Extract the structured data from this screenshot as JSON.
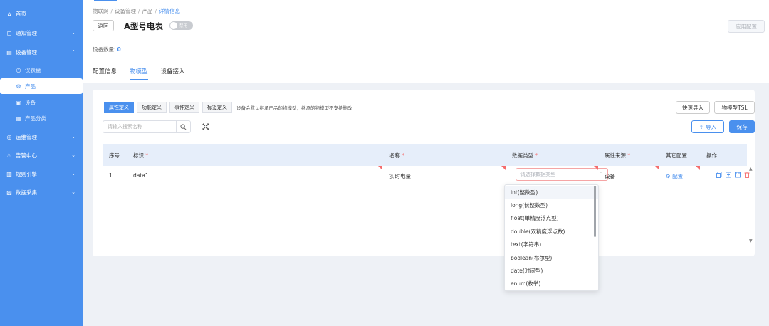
{
  "sidebar": {
    "items": [
      {
        "label": "首页",
        "icon": "home-icon"
      },
      {
        "label": "通知管理",
        "icon": "bell-icon"
      },
      {
        "label": "设备管理",
        "icon": "device-icon"
      },
      {
        "label": "仪表盘",
        "icon": "dashboard-icon"
      },
      {
        "label": "产品",
        "icon": "product-icon"
      },
      {
        "label": "设备",
        "icon": "device-list-icon"
      },
      {
        "label": "产品分类",
        "icon": "category-icon"
      },
      {
        "label": "运维管理",
        "icon": "ops-icon"
      },
      {
        "label": "告警中心",
        "icon": "alarm-icon"
      },
      {
        "label": "规则引擎",
        "icon": "rule-icon"
      },
      {
        "label": "数据采集",
        "icon": "collect-icon"
      }
    ]
  },
  "breadcrumb": {
    "items": [
      "物联网",
      "设备管理",
      "产品",
      "详情信息"
    ]
  },
  "header": {
    "back_label": "返回",
    "title": "A型号电表",
    "toggle_label": "禁用",
    "apply_label": "应用配置",
    "device_count_label": "设备数量:",
    "device_count": "0"
  },
  "tabs": [
    {
      "label": "配置信息",
      "active": false
    },
    {
      "label": "物模型",
      "active": true
    },
    {
      "label": "设备接入",
      "active": false
    }
  ],
  "subtabs": [
    {
      "label": "属性定义",
      "active": true
    },
    {
      "label": "功能定义",
      "active": false
    },
    {
      "label": "事件定义",
      "active": false
    },
    {
      "label": "标签定义",
      "active": false
    }
  ],
  "subtab_note": "设备会默认继承产品的物模型，继承的物模型不支持删改",
  "actions": {
    "quick_import": "快速导入",
    "tsl": "物模型TSL",
    "import": "导入",
    "save": "保存"
  },
  "search": {
    "placeholder": "请输入搜索名称"
  },
  "table": {
    "headers": [
      "序号",
      "标识",
      "名称",
      "数据类型",
      "属性来源",
      "其它配置",
      "操作"
    ],
    "rows": [
      {
        "index": "1",
        "id": "data1",
        "name": "实时电量",
        "dtype_placeholder": "请选择数据类型",
        "source": "设备",
        "config": "配置"
      }
    ]
  },
  "dropdown": {
    "options": [
      "int(整数型)",
      "long(长整数型)",
      "float(单精度浮点型)",
      "double(双精度浮点数)",
      "text(字符串)",
      "boolean(布尔型)",
      "date(时间型)",
      "enum(枚举)"
    ]
  },
  "colors": {
    "accent": "#4a90ee",
    "sidebar": "#4a90ee",
    "danger": "#f56c6c"
  }
}
